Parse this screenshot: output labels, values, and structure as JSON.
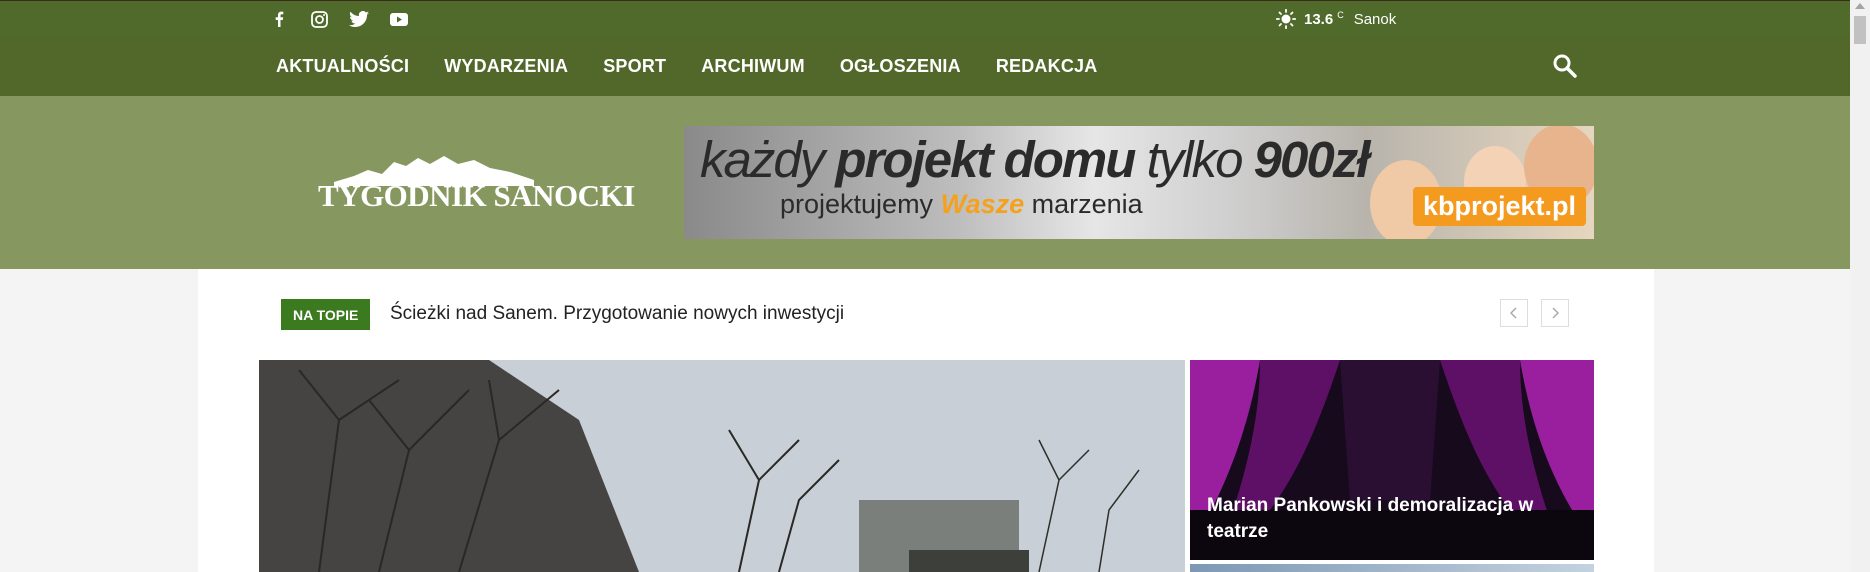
{
  "social": {
    "icons": [
      "facebook-icon",
      "instagram-icon",
      "twitter-icon",
      "youtube-icon"
    ]
  },
  "weather": {
    "temp": "13.6",
    "unit": "C",
    "city": "Sanok",
    "icon": "sun-icon"
  },
  "menu": {
    "items": [
      "AKTUALNOŚCI",
      "WYDARZENIA",
      "SPORT",
      "ARCHIWUM",
      "OGŁOSZENIA",
      "REDAKCJA"
    ]
  },
  "logo": {
    "text": "TYGODNIK SANOCKI"
  },
  "banner": {
    "line1_a": "każdy ",
    "line1_b": "projekt domu",
    "line1_c": " tylko ",
    "line1_d": "900",
    "line1_e": "zł",
    "line2_a": "projektujemy ",
    "line2_b": "Wasze",
    "line2_c": " marzenia",
    "badge": "kbprojekt.pl"
  },
  "trending": {
    "tag": "NA TOPIE",
    "title": "Ścieżki nad Sanem. Przygotowanie nowych inwestycji"
  },
  "featured": {
    "side_caption": "Marian Pankowski i demoralizacja w teatrze"
  },
  "colors": {
    "topbar": "#4f6a2a",
    "menubar": "#52682b",
    "header": "#869860",
    "tag": "#3b7a1e"
  }
}
